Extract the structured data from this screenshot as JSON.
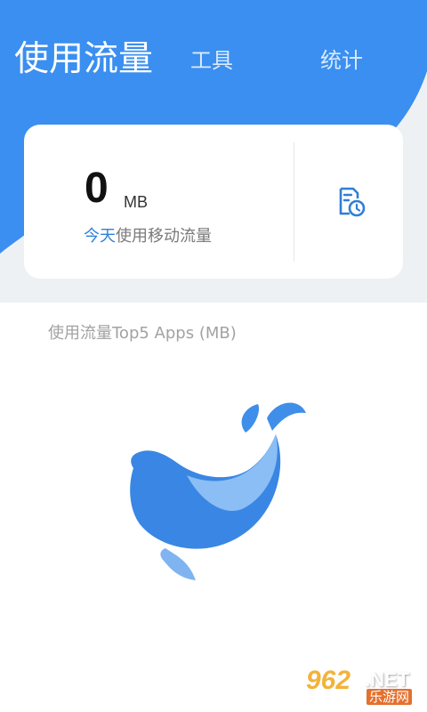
{
  "header": {
    "tabs": [
      {
        "label": "使用流量",
        "active": true
      },
      {
        "label": "工具",
        "active": false
      },
      {
        "label": "统计",
        "active": false
      }
    ],
    "accent_color": "#3a8ff0"
  },
  "summary": {
    "value": "0",
    "unit": "MB",
    "caption_highlight": "今天",
    "caption_rest": "使用移动流量",
    "history_icon": "history-clock-icon"
  },
  "top_apps": {
    "title": "使用流量Top5 Apps (MB)",
    "empty_illustration": "whale-icon"
  },
  "watermark": {
    "number": "962",
    "suffix": ".NET",
    "site": "乐游网"
  }
}
